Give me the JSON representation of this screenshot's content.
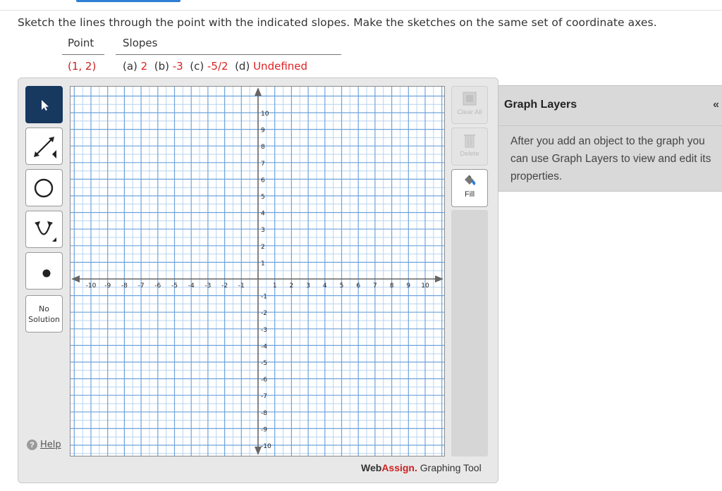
{
  "question": "Sketch the lines through the point with the indicated slopes. Make the sketches on the same set of coordinate axes.",
  "table": {
    "header_point": "Point",
    "header_slopes": "Slopes",
    "point": "(1, 2)",
    "slopes": [
      {
        "prefix": "(a) ",
        "value": "2"
      },
      {
        "prefix": "  (b) ",
        "value": "-3"
      },
      {
        "prefix": "  (c) ",
        "value": "-5/2"
      },
      {
        "prefix": "  (d) ",
        "value": "Undefined"
      }
    ]
  },
  "tools": {
    "pointer": "pointer-icon",
    "line": "line-icon",
    "circle": "circle-icon",
    "parabola": "parabola-icon",
    "point": "point-icon",
    "no_solution": "No Solution"
  },
  "help_label": "Help",
  "actions": {
    "clear_all": "Clear All",
    "delete": "Delete",
    "fill": "Fill"
  },
  "branding": {
    "web": "Web",
    "assign": "Assign.",
    "tool": " Graphing Tool"
  },
  "layers": {
    "title": "Graph Layers",
    "collapse": "«",
    "description": "After you add an object to the graph you can use Graph Layers to view and edit its properties."
  },
  "graph": {
    "xmin": -10,
    "xmax": 10,
    "ymin": -10,
    "ymax": 10,
    "minor_step": 0.5,
    "major_step": 1,
    "x_ticks": [
      "-10",
      "-9",
      "-8",
      "-7",
      "-6",
      "-5",
      "-4",
      "-3",
      "-2",
      "-1",
      "1",
      "2",
      "3",
      "4",
      "5",
      "6",
      "7",
      "8",
      "9",
      "10"
    ],
    "y_ticks": [
      "10",
      "9",
      "8",
      "7",
      "6",
      "5",
      "4",
      "3",
      "2",
      "1",
      "-1",
      "-2",
      "-3",
      "-4",
      "-5",
      "-6",
      "-7",
      "-8",
      "-9",
      "-10"
    ],
    "colors": {
      "minor": "#b8d4f0",
      "major": "#6fa3dc",
      "axis": "#666666"
    }
  }
}
